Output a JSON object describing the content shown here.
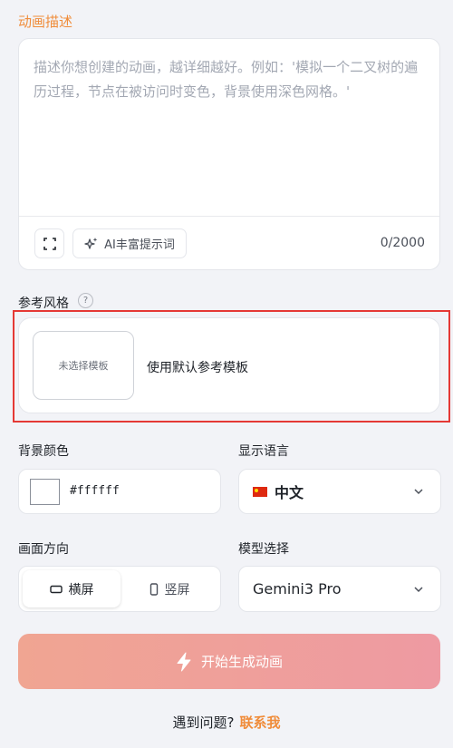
{
  "description": {
    "label": "动画描述",
    "placeholder": "描述你想创建的动画，越详细越好。例如：'模拟一个二叉树的遍历过程，节点在被访问时变色，背景使用深色网格。'",
    "ai_button_label": "AI丰富提示词",
    "counter": "0/2000"
  },
  "style": {
    "label": "参考风格",
    "help_symbol": "?",
    "thumbnail_text": "未选择模板",
    "template_label": "使用默认参考模板"
  },
  "background": {
    "label": "背景颜色",
    "value": "#ffffff"
  },
  "language": {
    "label": "显示语言",
    "value": "中文"
  },
  "orientation": {
    "label": "画面方向",
    "options": [
      "横屏",
      "竖屏"
    ],
    "selected": "横屏"
  },
  "model": {
    "label": "模型选择",
    "value": "Gemini3 Pro"
  },
  "generate_button": "开始生成动画",
  "footer": {
    "question": "遇到问题?",
    "contact": "联系我"
  },
  "colors": {
    "accent": "#f08c3a",
    "highlight_border": "#e53935",
    "button_gradient_start": "#f0a592",
    "button_gradient_end": "#ee9aa2"
  }
}
